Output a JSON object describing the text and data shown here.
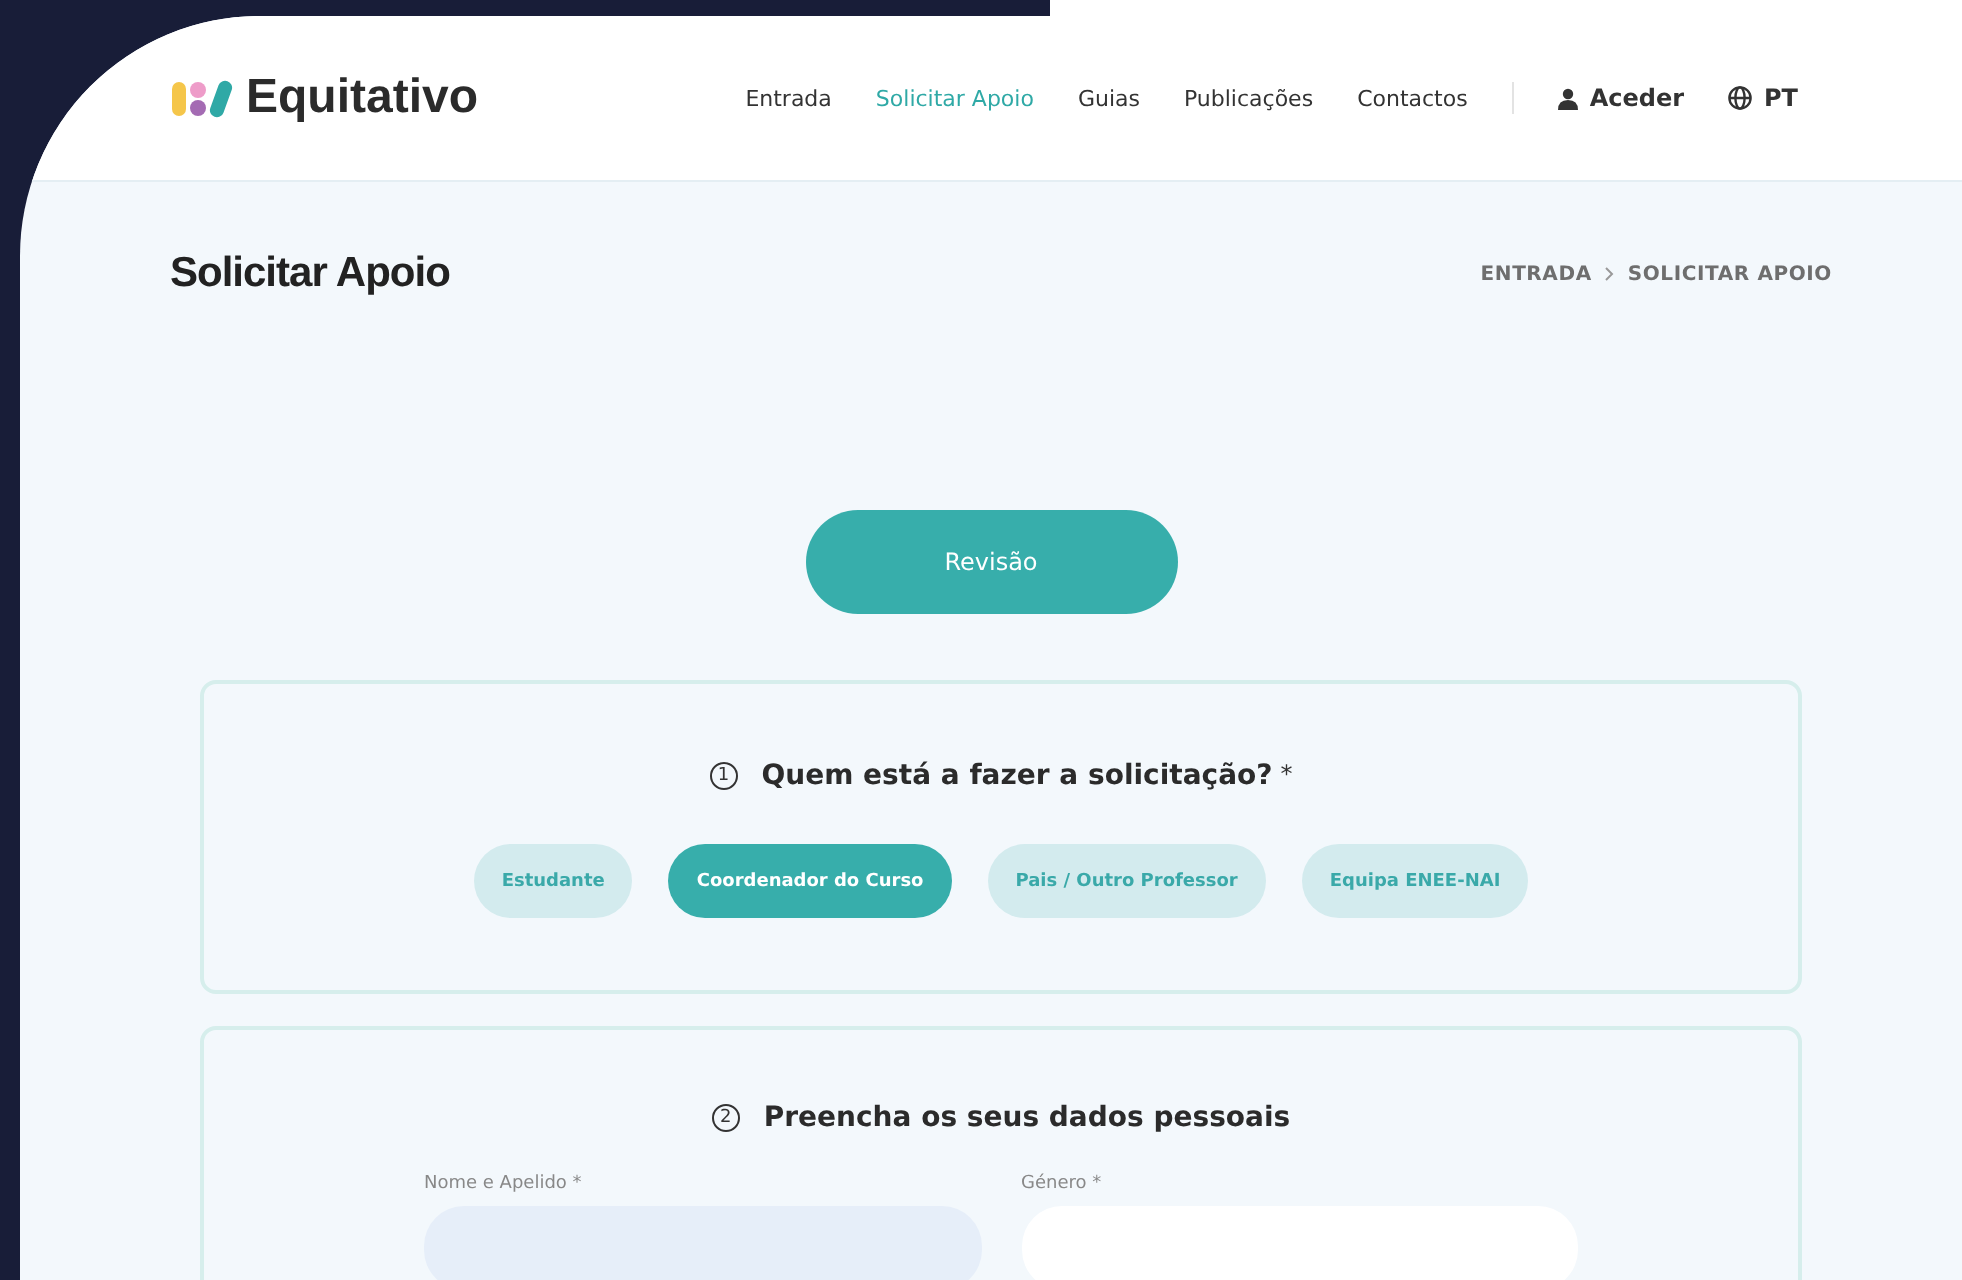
{
  "header": {
    "logo_text": "Equitativo",
    "nav": [
      {
        "label": "Entrada",
        "selected": false
      },
      {
        "label": "Solicitar Apoio",
        "selected": true
      },
      {
        "label": "Guias",
        "selected": false
      },
      {
        "label": "Publicações",
        "selected": false
      },
      {
        "label": "Contactos",
        "selected": false
      }
    ],
    "login": "Aceder",
    "language": "PT"
  },
  "page_title": "Solicitar Apoio",
  "breadcrumb": [
    "ENTRADA",
    "SOLICITAR APOIO"
  ],
  "review_button": "Revisão",
  "sections": [
    {
      "number": "1",
      "title": "Quem está a fazer a solicitação?",
      "required_mark": "*",
      "kind": "choices",
      "options": [
        {
          "label": "Estudante",
          "selected": false
        },
        {
          "label": "Coordenador do Curso",
          "selected": true
        },
        {
          "label": "Pais / Outro Professor",
          "selected": false
        },
        {
          "label": "Equipa ENEE-NAI",
          "selected": false
        }
      ]
    },
    {
      "number": "2",
      "title": "Preencha os seus dados pessoais",
      "kind": "fields",
      "fields": [
        {
          "label": "Nome e Apelido *"
        },
        {
          "label": "Género *"
        }
      ]
    }
  ]
}
